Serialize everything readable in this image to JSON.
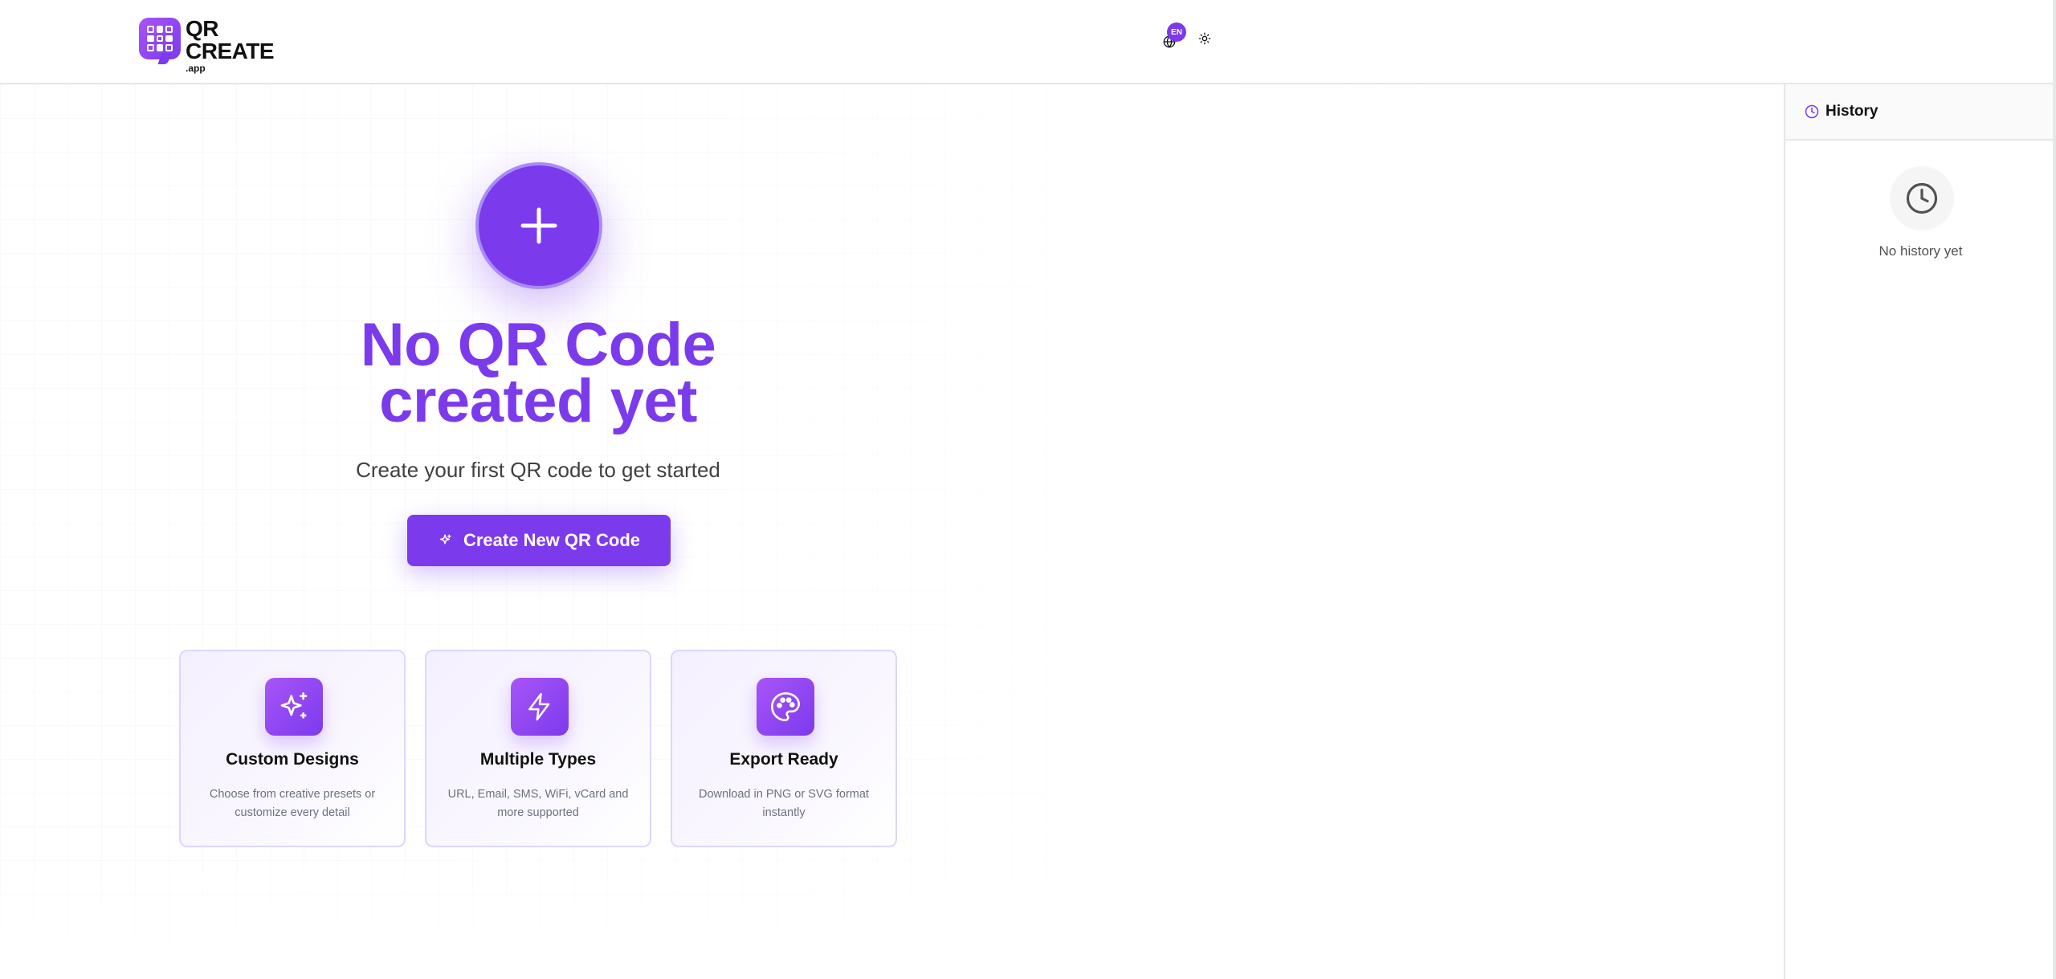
{
  "header": {
    "logo": {
      "line1": "QR",
      "line2": "CREATE",
      "line3": ".app"
    },
    "language": {
      "badge": "EN",
      "icon": "globe-icon"
    },
    "theme_toggle": {
      "icon": "sun-icon"
    }
  },
  "empty_state": {
    "icon": "plus-icon",
    "title_line1": "No QR Code",
    "title_line2": "created yet",
    "subtitle": "Create your first QR code to get started",
    "button": {
      "icon": "sparkles-icon",
      "label": "Create New QR Code"
    }
  },
  "features": [
    {
      "icon": "sparkles-icon",
      "title": "Custom Designs",
      "description": "Choose from creative presets or customize every detail"
    },
    {
      "icon": "lightning-icon",
      "title": "Multiple Types",
      "description": "URL, Email, SMS, WiFi, vCard and more supported"
    },
    {
      "icon": "palette-icon",
      "title": "Export Ready",
      "description": "Download in PNG or SVG format instantly"
    }
  ],
  "history": {
    "icon": "clock-icon",
    "title": "History",
    "empty_icon": "clock-icon",
    "empty_text": "No history yet"
  },
  "colors": {
    "accent": "#7c3aed",
    "accent_light": "#a855f7",
    "border": "#e5e7eb"
  }
}
